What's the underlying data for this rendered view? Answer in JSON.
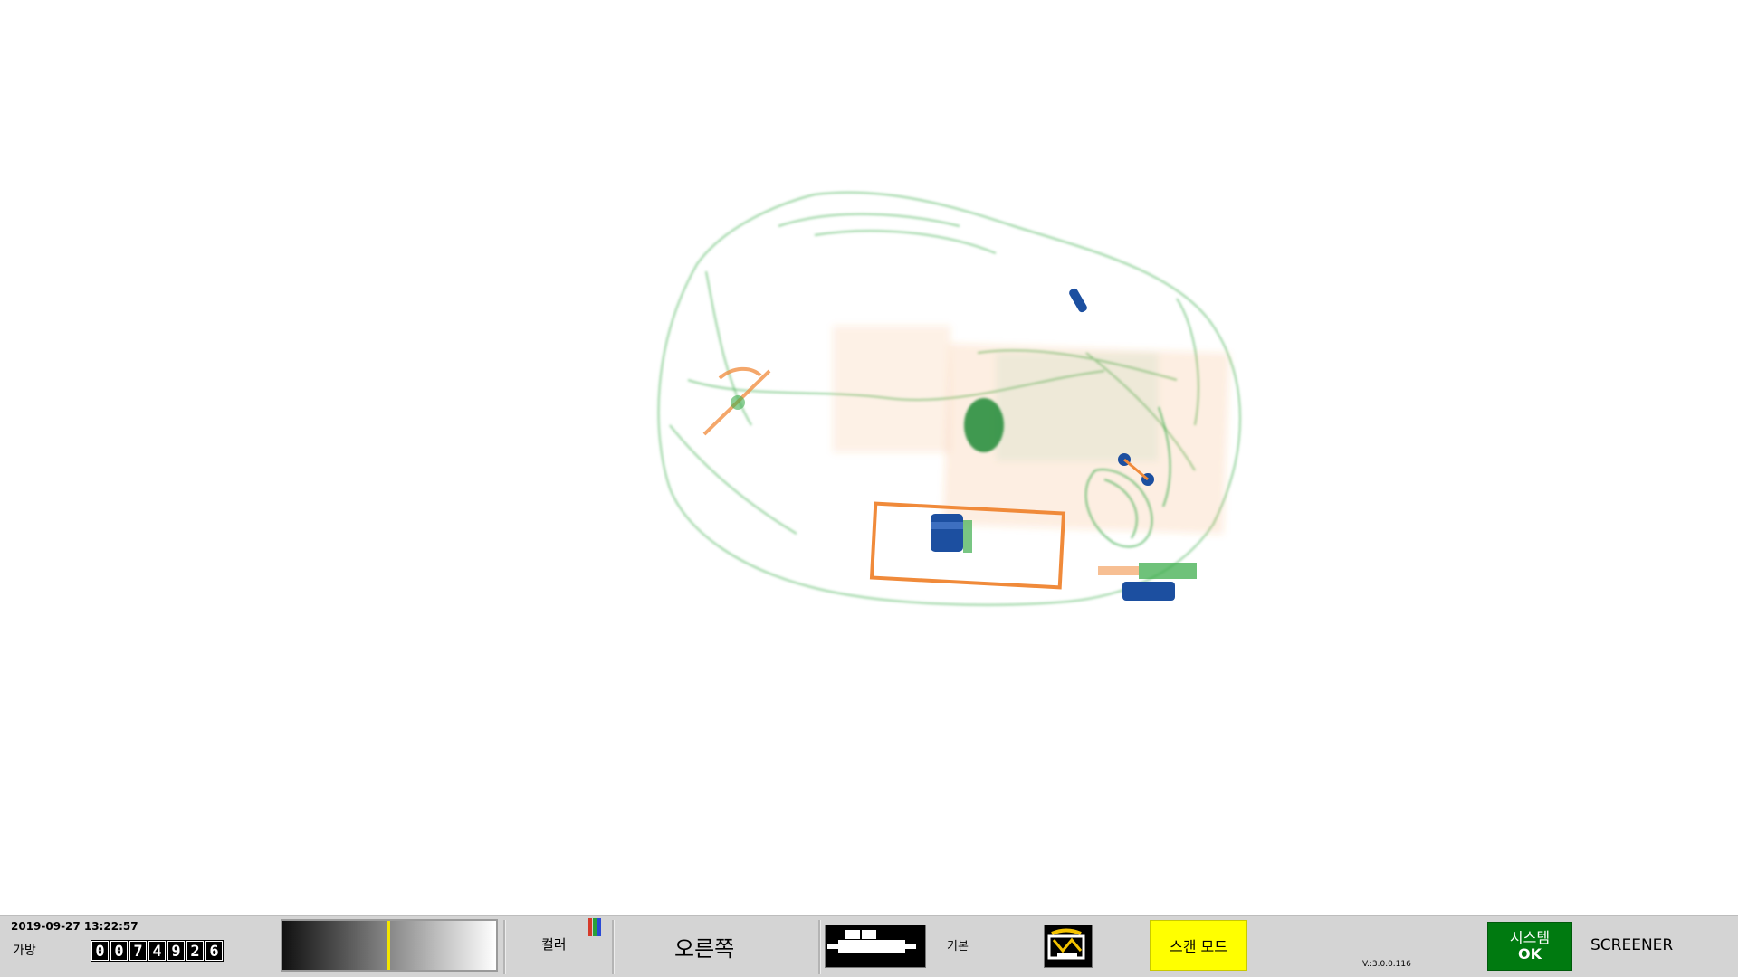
{
  "scan": {
    "description_hidden": "",
    "colors": {
      "organic": "#f08a3a",
      "inorganic": "#3fae4e",
      "metal": "#1c4fa0",
      "background": "#ffffff"
    }
  },
  "statusbar": {
    "datetime": "2019-09-27 13:22:57",
    "bag_label": "가방",
    "bag_counter": [
      "0",
      "0",
      "7",
      "4",
      "9",
      "2",
      "6"
    ],
    "gradient_level": 0.49,
    "gradient_marker_color": "#f3e500",
    "color_label": "컬러",
    "color_icon_colors": [
      "#d63a2a",
      "#2aa13a",
      "#2a4ad6"
    ],
    "orientation_label": "오른쪽",
    "conveyor_icon": "conveyor-icon",
    "basic_label": "기본",
    "screen_icon": "scan-image-icon",
    "scan_mode_label": "스캔 모드",
    "scan_mode_color": "#ffff00",
    "version": "V.:3.0.0.116",
    "system_label": "시스템",
    "system_status": "OK",
    "system_status_color": "#007a10",
    "role": "SCREENER"
  }
}
